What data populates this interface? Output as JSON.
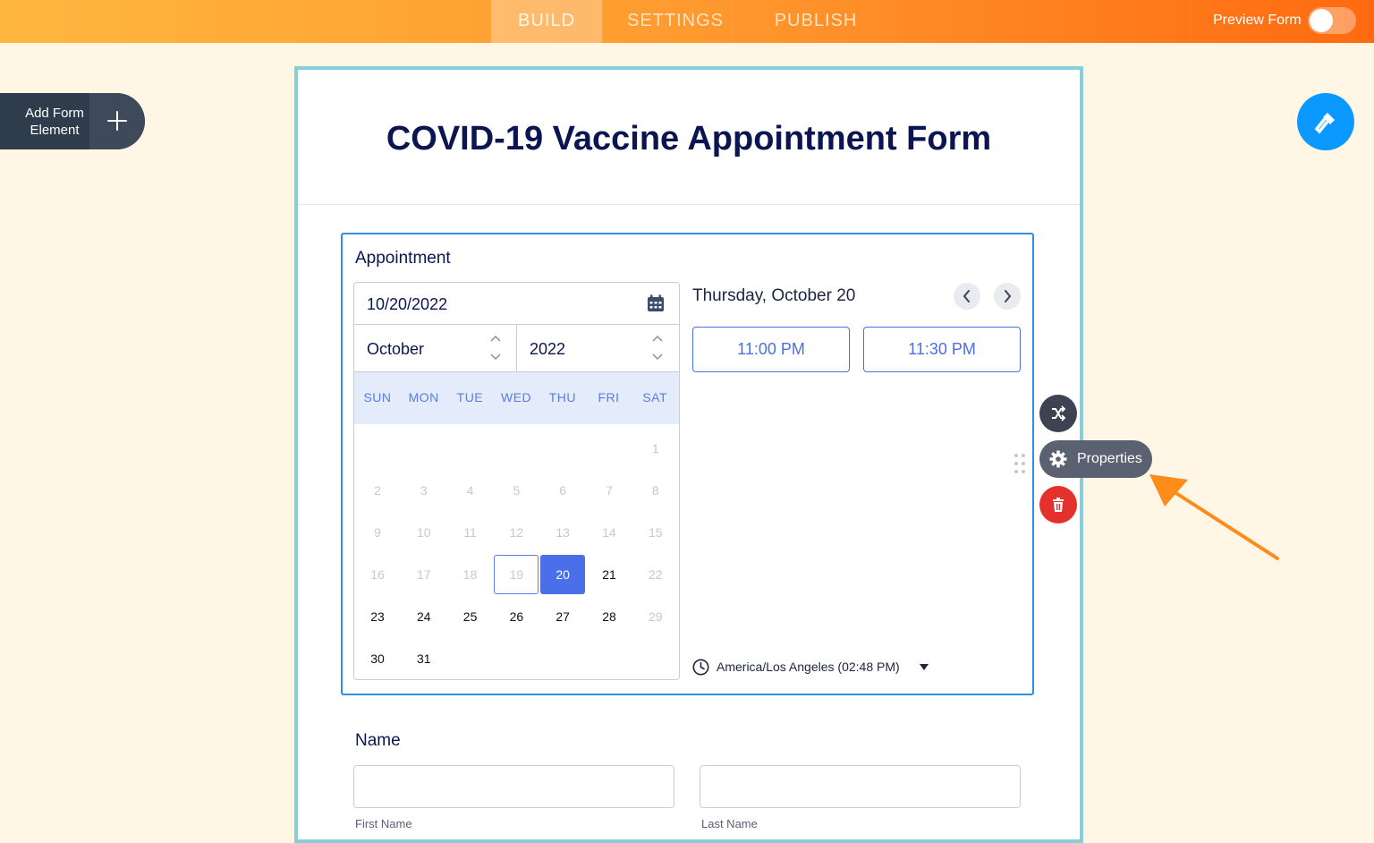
{
  "topbar": {
    "tabs": [
      {
        "label": "BUILD",
        "active": true
      },
      {
        "label": "SETTINGS",
        "active": false
      },
      {
        "label": "PUBLISH",
        "active": false
      }
    ],
    "preview_label": "Preview Form",
    "preview_enabled": false
  },
  "add_element": {
    "label": "Add Form Element"
  },
  "form": {
    "title": "COVID-19 Vaccine Appointment Form",
    "appointment": {
      "label": "Appointment",
      "date_value": "10/20/2022",
      "month": "October",
      "year": "2022",
      "weekdays": [
        "SUN",
        "MON",
        "TUE",
        "WED",
        "THU",
        "FRI",
        "SAT"
      ],
      "days": [
        {
          "d": "1",
          "state": "dim"
        },
        {
          "d": "2",
          "state": "dim"
        },
        {
          "d": "3",
          "state": "dim"
        },
        {
          "d": "4",
          "state": "dim"
        },
        {
          "d": "5",
          "state": "dim"
        },
        {
          "d": "6",
          "state": "dim"
        },
        {
          "d": "7",
          "state": "dim"
        },
        {
          "d": "8",
          "state": "dim"
        },
        {
          "d": "9",
          "state": "dim"
        },
        {
          "d": "10",
          "state": "dim"
        },
        {
          "d": "11",
          "state": "dim"
        },
        {
          "d": "12",
          "state": "dim"
        },
        {
          "d": "13",
          "state": "dim"
        },
        {
          "d": "14",
          "state": "dim"
        },
        {
          "d": "15",
          "state": "dim"
        },
        {
          "d": "16",
          "state": "dim"
        },
        {
          "d": "17",
          "state": "dim"
        },
        {
          "d": "18",
          "state": "dim"
        },
        {
          "d": "19",
          "state": "outlined"
        },
        {
          "d": "20",
          "state": "selected"
        },
        {
          "d": "21",
          "state": "normal"
        },
        {
          "d": "22",
          "state": "dim"
        },
        {
          "d": "23",
          "state": "normal"
        },
        {
          "d": "24",
          "state": "normal"
        },
        {
          "d": "25",
          "state": "normal"
        },
        {
          "d": "26",
          "state": "normal"
        },
        {
          "d": "27",
          "state": "normal"
        },
        {
          "d": "28",
          "state": "normal"
        },
        {
          "d": "29",
          "state": "dim"
        },
        {
          "d": "30",
          "state": "normal"
        },
        {
          "d": "31",
          "state": "normal"
        }
      ],
      "first_weekday_index": 6,
      "day_heading": "Thursday, October 20",
      "time_slots": [
        "11:00 PM",
        "11:30 PM"
      ],
      "timezone": "America/Los Angeles (02:48 PM)"
    },
    "name": {
      "label": "Name",
      "first_sublabel": "First Name",
      "last_sublabel": "Last Name"
    }
  },
  "tools": {
    "properties_label": "Properties",
    "shuffle_icon": "shuffle-icon",
    "settings_icon": "gear-icon",
    "delete_icon": "trash-icon"
  },
  "colors": {
    "accent_orange": "#ff6a10",
    "accent_blue": "#4a6fe8",
    "danger": "#e5312b",
    "title_navy": "#0a1551"
  }
}
